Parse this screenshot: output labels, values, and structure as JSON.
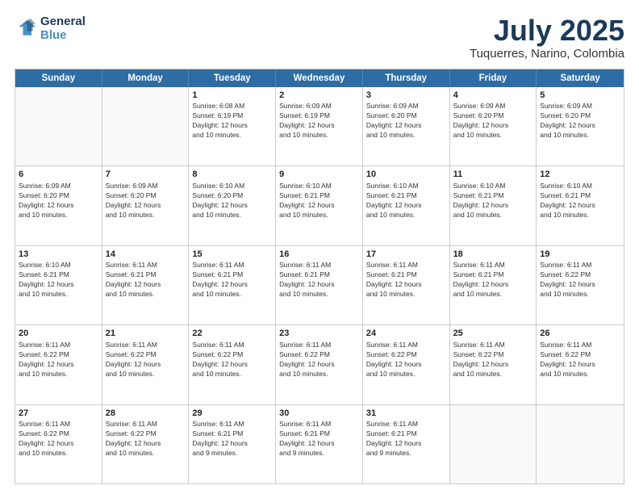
{
  "header": {
    "logo_line1": "General",
    "logo_line2": "Blue",
    "month": "July 2025",
    "location": "Tuquerres, Narino, Colombia"
  },
  "weekdays": [
    "Sunday",
    "Monday",
    "Tuesday",
    "Wednesday",
    "Thursday",
    "Friday",
    "Saturday"
  ],
  "rows": [
    [
      {
        "day": "",
        "info": ""
      },
      {
        "day": "",
        "info": ""
      },
      {
        "day": "1",
        "info": "Sunrise: 6:08 AM\nSunset: 6:19 PM\nDaylight: 12 hours\nand 10 minutes."
      },
      {
        "day": "2",
        "info": "Sunrise: 6:09 AM\nSunset: 6:19 PM\nDaylight: 12 hours\nand 10 minutes."
      },
      {
        "day": "3",
        "info": "Sunrise: 6:09 AM\nSunset: 6:20 PM\nDaylight: 12 hours\nand 10 minutes."
      },
      {
        "day": "4",
        "info": "Sunrise: 6:09 AM\nSunset: 6:20 PM\nDaylight: 12 hours\nand 10 minutes."
      },
      {
        "day": "5",
        "info": "Sunrise: 6:09 AM\nSunset: 6:20 PM\nDaylight: 12 hours\nand 10 minutes."
      }
    ],
    [
      {
        "day": "6",
        "info": "Sunrise: 6:09 AM\nSunset: 6:20 PM\nDaylight: 12 hours\nand 10 minutes."
      },
      {
        "day": "7",
        "info": "Sunrise: 6:09 AM\nSunset: 6:20 PM\nDaylight: 12 hours\nand 10 minutes."
      },
      {
        "day": "8",
        "info": "Sunrise: 6:10 AM\nSunset: 6:20 PM\nDaylight: 12 hours\nand 10 minutes."
      },
      {
        "day": "9",
        "info": "Sunrise: 6:10 AM\nSunset: 6:21 PM\nDaylight: 12 hours\nand 10 minutes."
      },
      {
        "day": "10",
        "info": "Sunrise: 6:10 AM\nSunset: 6:21 PM\nDaylight: 12 hours\nand 10 minutes."
      },
      {
        "day": "11",
        "info": "Sunrise: 6:10 AM\nSunset: 6:21 PM\nDaylight: 12 hours\nand 10 minutes."
      },
      {
        "day": "12",
        "info": "Sunrise: 6:10 AM\nSunset: 6:21 PM\nDaylight: 12 hours\nand 10 minutes."
      }
    ],
    [
      {
        "day": "13",
        "info": "Sunrise: 6:10 AM\nSunset: 6:21 PM\nDaylight: 12 hours\nand 10 minutes."
      },
      {
        "day": "14",
        "info": "Sunrise: 6:11 AM\nSunset: 6:21 PM\nDaylight: 12 hours\nand 10 minutes."
      },
      {
        "day": "15",
        "info": "Sunrise: 6:11 AM\nSunset: 6:21 PM\nDaylight: 12 hours\nand 10 minutes."
      },
      {
        "day": "16",
        "info": "Sunrise: 6:11 AM\nSunset: 6:21 PM\nDaylight: 12 hours\nand 10 minutes."
      },
      {
        "day": "17",
        "info": "Sunrise: 6:11 AM\nSunset: 6:21 PM\nDaylight: 12 hours\nand 10 minutes."
      },
      {
        "day": "18",
        "info": "Sunrise: 6:11 AM\nSunset: 6:21 PM\nDaylight: 12 hours\nand 10 minutes."
      },
      {
        "day": "19",
        "info": "Sunrise: 6:11 AM\nSunset: 6:22 PM\nDaylight: 12 hours\nand 10 minutes."
      }
    ],
    [
      {
        "day": "20",
        "info": "Sunrise: 6:11 AM\nSunset: 6:22 PM\nDaylight: 12 hours\nand 10 minutes."
      },
      {
        "day": "21",
        "info": "Sunrise: 6:11 AM\nSunset: 6:22 PM\nDaylight: 12 hours\nand 10 minutes."
      },
      {
        "day": "22",
        "info": "Sunrise: 6:11 AM\nSunset: 6:22 PM\nDaylight: 12 hours\nand 10 minutes."
      },
      {
        "day": "23",
        "info": "Sunrise: 6:11 AM\nSunset: 6:22 PM\nDaylight: 12 hours\nand 10 minutes."
      },
      {
        "day": "24",
        "info": "Sunrise: 6:11 AM\nSunset: 6:22 PM\nDaylight: 12 hours\nand 10 minutes."
      },
      {
        "day": "25",
        "info": "Sunrise: 6:11 AM\nSunset: 6:22 PM\nDaylight: 12 hours\nand 10 minutes."
      },
      {
        "day": "26",
        "info": "Sunrise: 6:11 AM\nSunset: 6:22 PM\nDaylight: 12 hours\nand 10 minutes."
      }
    ],
    [
      {
        "day": "27",
        "info": "Sunrise: 6:11 AM\nSunset: 6:22 PM\nDaylight: 12 hours\nand 10 minutes."
      },
      {
        "day": "28",
        "info": "Sunrise: 6:11 AM\nSunset: 6:22 PM\nDaylight: 12 hours\nand 10 minutes."
      },
      {
        "day": "29",
        "info": "Sunrise: 6:11 AM\nSunset: 6:21 PM\nDaylight: 12 hours\nand 9 minutes."
      },
      {
        "day": "30",
        "info": "Sunrise: 6:11 AM\nSunset: 6:21 PM\nDaylight: 12 hours\nand 9 minutes."
      },
      {
        "day": "31",
        "info": "Sunrise: 6:11 AM\nSunset: 6:21 PM\nDaylight: 12 hours\nand 9 minutes."
      },
      {
        "day": "",
        "info": ""
      },
      {
        "day": "",
        "info": ""
      }
    ]
  ]
}
